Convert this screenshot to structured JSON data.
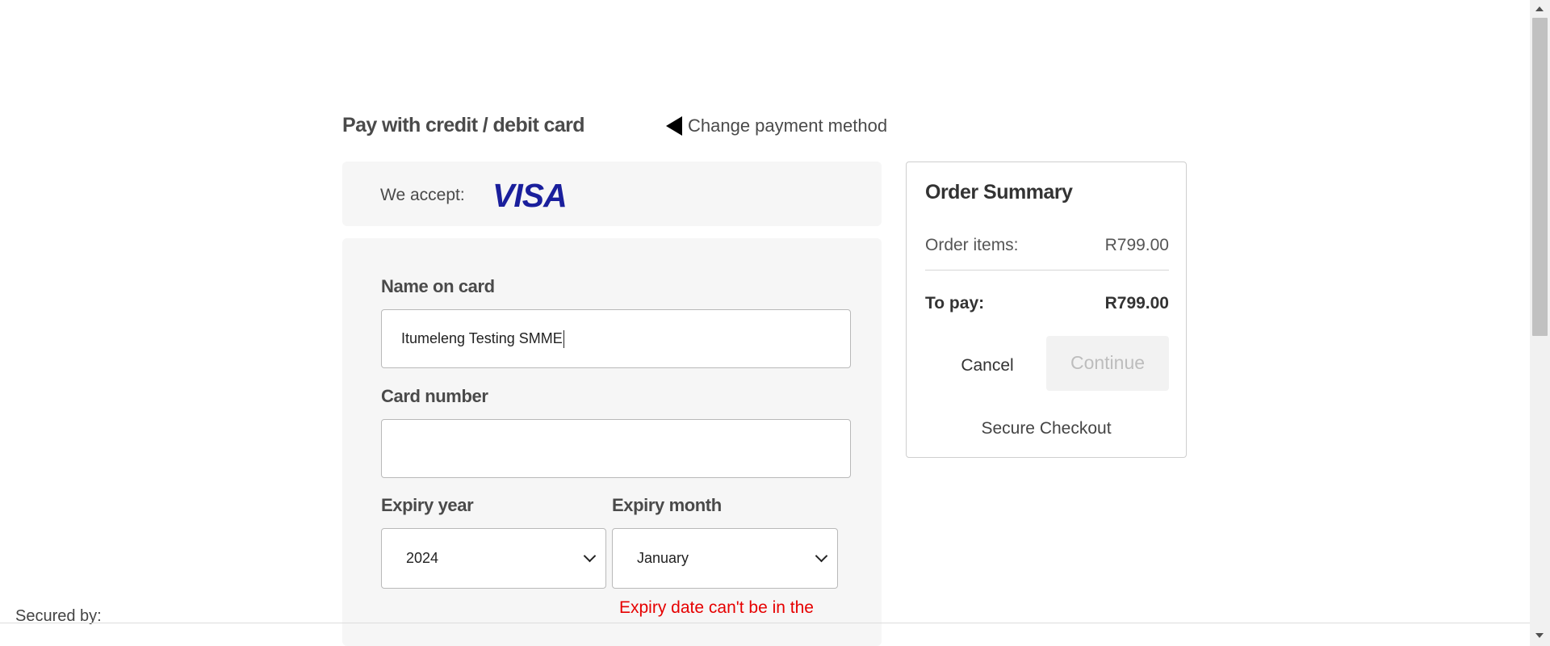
{
  "payment": {
    "heading": "Pay with credit / debit card",
    "change_method_label": "Change payment method",
    "accept_label": "We accept:",
    "card_brand": "VISA",
    "brand_color": "#1a1f9c"
  },
  "form": {
    "name_label": "Name on card",
    "name_value": "Itumeleng Testing SMME",
    "card_number_label": "Card number",
    "card_number_value": "",
    "expiry_year_label": "Expiry year",
    "expiry_year_value": "2024",
    "expiry_month_label": "Expiry month",
    "expiry_month_value": "January",
    "error_message": "Expiry date can't be in the",
    "error_color": "#e60000"
  },
  "summary": {
    "title": "Order Summary",
    "items_label": "Order items:",
    "items_value": "R799.00",
    "total_label": "To pay:",
    "total_value": "R799.00",
    "cancel_label": "Cancel",
    "continue_label": "Continue",
    "secure_label": "Secure Checkout"
  },
  "footer": {
    "secured_by_label": "Secured by:"
  }
}
